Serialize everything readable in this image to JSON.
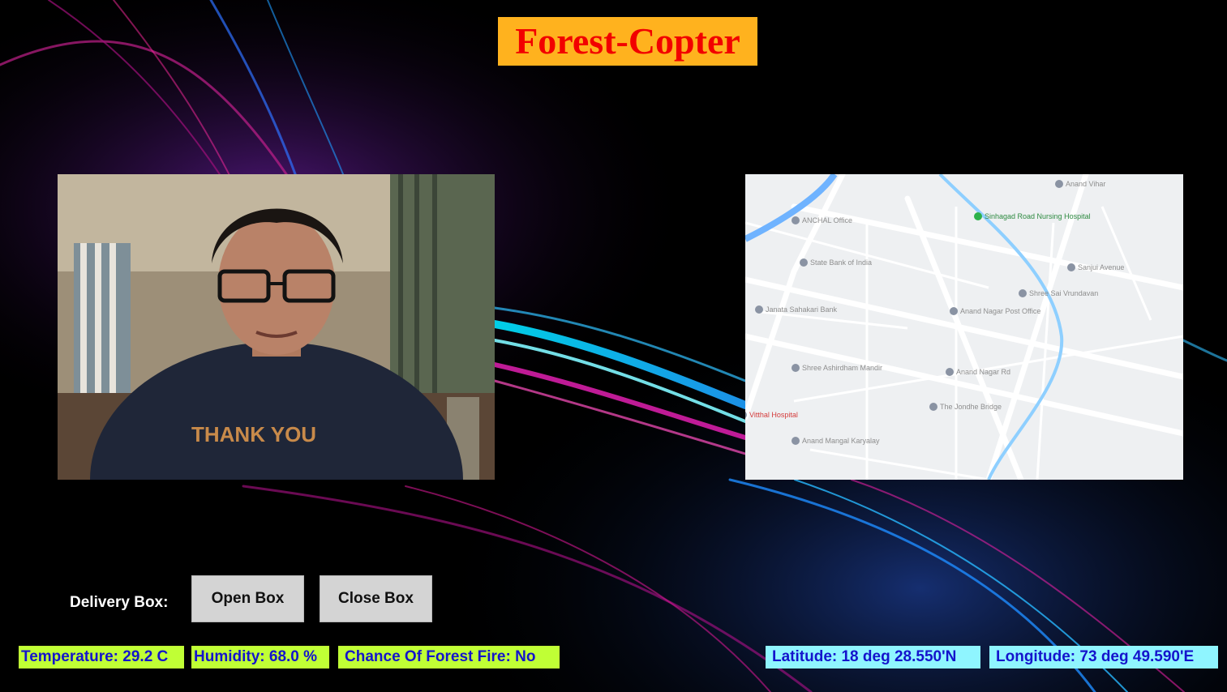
{
  "app": {
    "title": "Forest-Copter"
  },
  "panels": {
    "camera_label": "camera-feed",
    "map_places": [
      "Anand Vihar",
      "ANCHAL Office",
      "Sinhagad Road Nursing Hospital",
      "State Bank of India",
      "Janata Sahakari Bank",
      "Sanjui Avenue",
      "Anand Nagar Post Office",
      "Shree Ashirdham Mandir",
      "Anand Nagar Rd",
      "The Jondhe Bridge",
      "Anand Mangal Karyalay",
      "Shree Sai Vrundavan",
      "Vitthal Hospital"
    ]
  },
  "controls": {
    "delivery_label": "Delivery Box:",
    "open_label": "Open Box",
    "close_label": "Close Box"
  },
  "status": {
    "temperature": "Temperature: 29.2 C",
    "humidity": "Humidity: 68.0 %",
    "fire": "Chance Of Forest Fire: No",
    "latitude": "Latitude: 18 deg 28.550'N",
    "longitude": "Longitude: 73 deg 49.590'E"
  },
  "colors": {
    "title_bg": "#ffb21e",
    "title_text": "#f20000",
    "green_badge": "#c0ff35",
    "cyan_badge": "#8ff5ff",
    "badge_text": "#1414cc"
  }
}
